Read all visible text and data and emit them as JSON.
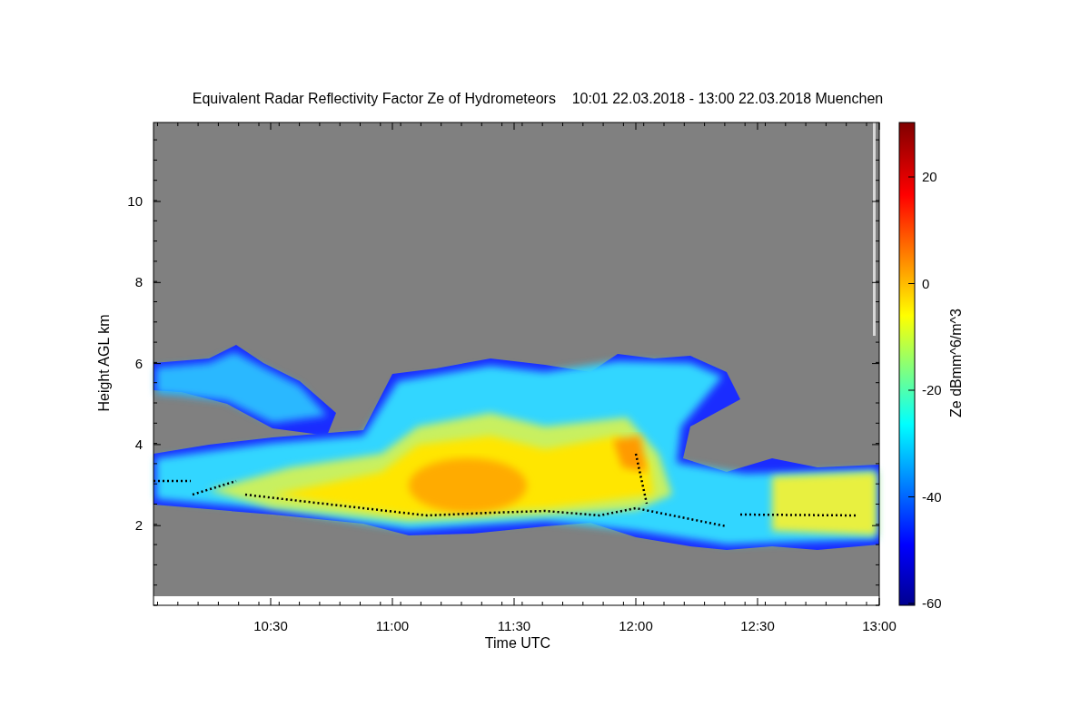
{
  "title": "Equivalent Radar Reflectivity Factor Ze of Hydrometeors    10:01 22.03.2018 - 13:00 22.03.2018 Muenchen",
  "xlabel": "Time UTC",
  "ylabel": "Height AGL km",
  "xticks": [
    "10:30",
    "11:00",
    "11:30",
    "12:00",
    "12:30",
    "13:00"
  ],
  "yticks": [
    "10",
    "8",
    "6",
    "4",
    "2"
  ],
  "colorbar": {
    "label": "Ze dBmm^6/m^3",
    "ticks": [
      "20",
      "0",
      "-20",
      "-40",
      "-60"
    ]
  }
}
